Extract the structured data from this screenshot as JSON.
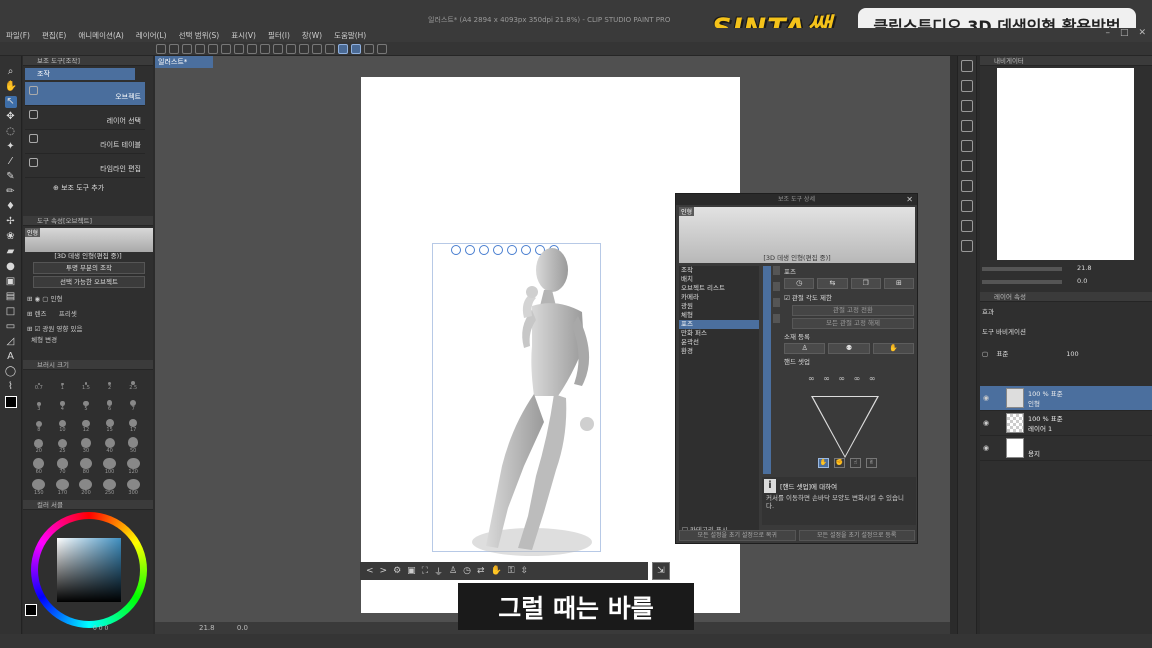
{
  "window": {
    "app_title": "일러스트* (A4 2894 x 4093px 350dpi 21.8%) - CLIP STUDIO PAINT PRO"
  },
  "overlay": {
    "logo": "SINTA쌤",
    "video_title": "클립스튜디오 3D 데생인형 활용방법",
    "subtitle": "그럴 때는 바를"
  },
  "menu": [
    "파일(F)",
    "편집(E)",
    "애니메이션(A)",
    "레이어(L)",
    "선택 범위(S)",
    "표시(V)",
    "필터(I)",
    "창(W)",
    "도움말(H)"
  ],
  "subtool": {
    "header": "보조 도구[조작]",
    "tab": "조작",
    "items": [
      {
        "label": "오브젝트",
        "selected": true
      },
      {
        "label": "레이어 선택",
        "selected": false
      },
      {
        "label": "라이트 테이블",
        "selected": false
      },
      {
        "label": "타임라인 편집",
        "selected": false
      }
    ],
    "add_label": "보조 도구 추가"
  },
  "tool_property": {
    "header": "도구 속성[오브젝트]",
    "preview_tag": "인형",
    "caption": "[3D 데생 인형(편집 중)]",
    "row1": "투명 부분의 조작",
    "row2": "선택 가능한 오브젝트",
    "doll_name": "인형",
    "lens_label": "렌즈",
    "preset_label": "프리셋",
    "light_label": "광원 영향 있음",
    "body_label": "체형 변경"
  },
  "brush_size": {
    "header": "브러시 크기",
    "values": [
      "0.7",
      "1",
      "1.5",
      "2",
      "2.5",
      "3",
      "4",
      "5",
      "6",
      "7",
      "8",
      "10",
      "12",
      "15",
      "17",
      "20",
      "25",
      "30",
      "40",
      "50",
      "60",
      "70",
      "80",
      "100",
      "120",
      "150",
      "170",
      "200",
      "250",
      "300"
    ]
  },
  "color": {
    "header": "컬러 서클",
    "readout": "0  0  0",
    "accent": "#4b6f9e"
  },
  "canvas": {
    "doc_tab": "일러스트*",
    "zoom": "21.8",
    "angle": "0.0"
  },
  "detail": {
    "title": "보조 도구 상세",
    "preview_tag": "인형",
    "preview_caption": "[3D 데생 인형(편집 중)]",
    "categories": [
      {
        "label": "조작",
        "selected": false
      },
      {
        "label": "배치",
        "selected": false
      },
      {
        "label": "오브젝트 리스트",
        "selected": false
      },
      {
        "label": "카메라",
        "selected": false
      },
      {
        "label": "광원",
        "selected": false
      },
      {
        "label": "체형",
        "selected": false
      },
      {
        "label": "포즈",
        "selected": true
      },
      {
        "label": "만화 퍼스",
        "selected": false
      },
      {
        "label": "윤곽선",
        "selected": false
      },
      {
        "label": "환경",
        "selected": false
      }
    ],
    "category_footer": "카테고리 표시",
    "pose_label": "포즈",
    "joint_limit": "관절 각도 제한",
    "joint_fix": "관절 고정 전환",
    "joint_unfix_all": "모든 관절 고정 해제",
    "material_label": "소재 등록",
    "hand_setup_label": "핸드 셋업",
    "info_title": "[핸드 셋업]에 대하여",
    "info_text": "커서를 이동하면 손바닥 모양도 변화시킬 수 있습니다.",
    "footer_left": "모든 설정을 초기 설정으로 복귀",
    "footer_right": "모든 설정을 초기 설정으로 등록"
  },
  "navigator": {
    "header": "내비게이터",
    "zoom": "21.8",
    "angle": "0.0"
  },
  "layer_property": {
    "header": "레이어 속성",
    "effect_label": "효과",
    "palette_label": "도구 바비게이션"
  },
  "layers": {
    "blend_mode": "표준",
    "opacity": "100",
    "items": [
      {
        "line1": "100 % 표준",
        "line2": "인형",
        "selected": true
      },
      {
        "line1": "100 % 표준",
        "line2": "레이어 1",
        "selected": false
      },
      {
        "line1": "",
        "line2": "용지",
        "selected": false
      }
    ]
  }
}
